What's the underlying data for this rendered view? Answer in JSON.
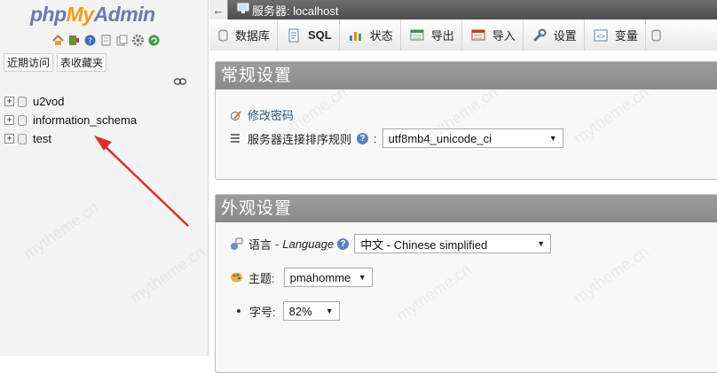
{
  "nav": {
    "logo": {
      "php": "php",
      "my": "My",
      "admin": "Admin"
    },
    "icons": [
      "home-icon",
      "exit-icon",
      "help-icon",
      "docs-icon",
      "copy-icon",
      "settings-icon",
      "reload-icon"
    ],
    "tabs": {
      "recent": "近期访问",
      "favorites": "表收藏夹"
    },
    "databases": [
      "u2vod",
      "information_schema",
      "test"
    ]
  },
  "topbar": {
    "back": "←",
    "title": "服务器: localhost"
  },
  "menu": {
    "tabs": [
      {
        "label": "数据库",
        "icon": "database-icon"
      },
      {
        "label": "SQL",
        "icon": "sql-icon"
      },
      {
        "label": "状态",
        "icon": "status-icon"
      },
      {
        "label": "导出",
        "icon": "export-icon"
      },
      {
        "label": "导入",
        "icon": "import-icon"
      },
      {
        "label": "设置",
        "icon": "settings-icon"
      },
      {
        "label": "变量",
        "icon": "variables-icon"
      }
    ]
  },
  "general": {
    "title": "常规设置",
    "change_password": "修改密码",
    "collation_label": "服务器连接排序规则",
    "collation_sep": ":",
    "collation_value": "utf8mb4_unicode_ci"
  },
  "appearance": {
    "title": "外观设置",
    "language_label": "语言",
    "language_dash": "-",
    "language_en": "Language",
    "language_value": "中文 - Chinese simplified",
    "theme_label": "主题:",
    "theme_value": "pmahomme",
    "fontsize_label": "字号:",
    "fontsize_value": "82%"
  },
  "watermark": "mytheme.cn",
  "colors": {
    "link": "#235a81",
    "panel_header": "#8a8a8a",
    "arrow": "#d9302c"
  }
}
